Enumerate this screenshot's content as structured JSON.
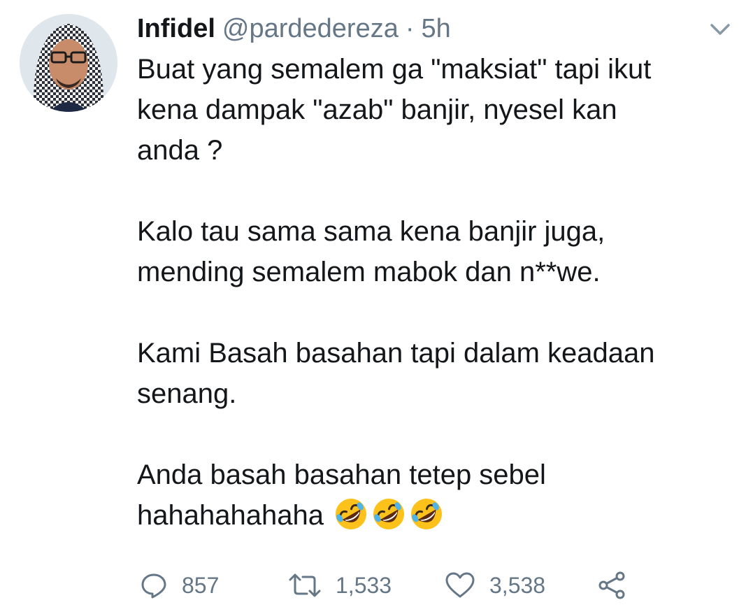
{
  "tweet": {
    "display_name": "Infidel",
    "handle": "@pardedereza",
    "separator": "·",
    "time": "5h",
    "paragraphs": [
      [
        "Buat yang semalem ga \"maksiat\" tapi ikut",
        "kena dampak \"azab\" banjir, nyesel kan",
        "anda ?"
      ],
      [
        "Kalo tau sama sama kena banjir juga,",
        "mending semalem mabok dan n**we."
      ],
      [
        "Kami Basah basahan tapi dalam keadaan",
        "senang."
      ],
      [
        "Anda basah basahan tetep sebel"
      ]
    ],
    "last_line": "hahahahahaha",
    "emoji": [
      "rolling-on-floor-laughing-emoji",
      "rolling-on-floor-laughing-emoji",
      "rolling-on-floor-laughing-emoji"
    ]
  },
  "actions": {
    "reply_count": "857",
    "retweet_count": "1,533",
    "like_count": "3,538"
  },
  "icons": {
    "reply": "reply-icon",
    "retweet": "retweet-icon",
    "like": "heart-icon",
    "share": "share-icon",
    "menu": "chevron-down-icon"
  },
  "colors": {
    "text": "#14171a",
    "secondary": "#657786",
    "emoji_face": "#fcc21b"
  }
}
